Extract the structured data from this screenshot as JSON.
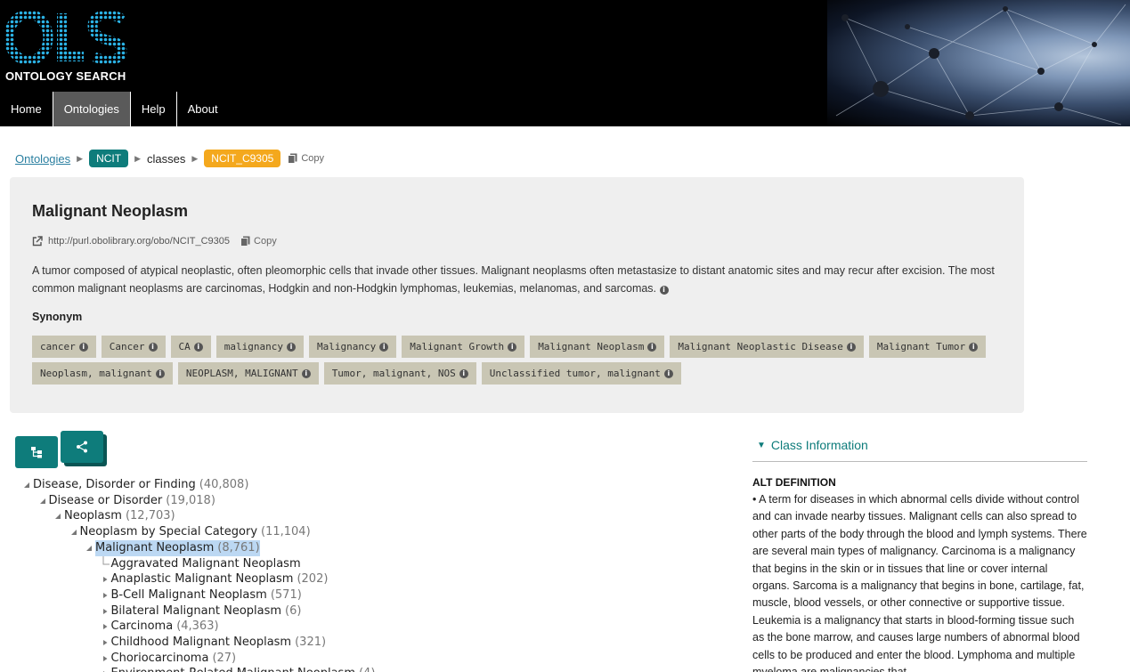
{
  "header": {
    "logo_letters": "OLS",
    "logo_subtitle": "ONTOLOGY SEARCH",
    "nav": [
      {
        "label": "Home"
      },
      {
        "label": "Ontologies"
      },
      {
        "label": "Help"
      },
      {
        "label": "About"
      }
    ],
    "active_nav": "Ontologies"
  },
  "breadcrumb": {
    "root": "Ontologies",
    "ontology": "NCIT",
    "type": "classes",
    "term_id": "NCIT_C9305",
    "copy_label": "Copy"
  },
  "term": {
    "title": "Malignant Neoplasm",
    "iri": "http://purl.obolibrary.org/obo/NCIT_C9305",
    "iri_copy_label": "Copy",
    "description": "A tumor composed of atypical neoplastic, often pleomorphic cells that invade other tissues. Malignant neoplasms often metastasize to distant anatomic sites and may recur after excision. The most common malignant neoplasms are carcinomas, Hodgkin and non-Hodgkin lymphomas, leukemias, melanomas, and sarcomas.",
    "synonym_label": "Synonym",
    "synonyms_row1": [
      "cancer",
      "Cancer",
      "CA",
      "malignancy",
      "Malignancy",
      "Malignant Growth",
      "Malignant Neoplasm",
      "Malignant Neoplastic Disease",
      "Malignant Tumor"
    ],
    "synonyms_row2": [
      "Neoplasm, malignant",
      "NEOPLASM, MALIGNANT",
      "Tumor, malignant, NOS",
      "Unclassified tumor, malignant"
    ]
  },
  "tree": {
    "rows": [
      {
        "label": "Disease, Disorder or Finding",
        "count": "(40,808)",
        "state": "open",
        "depth": 0
      },
      {
        "label": "Disease or Disorder",
        "count": "(19,018)",
        "state": "open",
        "depth": 1
      },
      {
        "label": "Neoplasm",
        "count": "(12,703)",
        "state": "open",
        "depth": 2
      },
      {
        "label": "Neoplasm by Special Category",
        "count": "(11,104)",
        "state": "open",
        "depth": 3
      },
      {
        "label": "Malignant Neoplasm",
        "count": "(8,761)",
        "state": "open",
        "depth": 4,
        "selected": true
      },
      {
        "label": "Aggravated Malignant Neoplasm",
        "count": "",
        "state": "leaf",
        "depth": 5
      },
      {
        "label": "Anaplastic Malignant Neoplasm",
        "count": "(202)",
        "state": "closed",
        "depth": 5
      },
      {
        "label": "B-Cell Malignant Neoplasm",
        "count": "(571)",
        "state": "closed",
        "depth": 5
      },
      {
        "label": "Bilateral Malignant Neoplasm",
        "count": "(6)",
        "state": "closed",
        "depth": 5
      },
      {
        "label": "Carcinoma",
        "count": "(4,363)",
        "state": "closed",
        "depth": 5
      },
      {
        "label": "Childhood Malignant Neoplasm",
        "count": "(321)",
        "state": "closed",
        "depth": 5
      },
      {
        "label": "Choriocarcinoma",
        "count": "(27)",
        "state": "closed",
        "depth": 5
      },
      {
        "label": "Environment-Related Malignant Neoplasm",
        "count": "(4)",
        "state": "closed",
        "depth": 5
      }
    ]
  },
  "class_info": {
    "header": "Class Information",
    "alt_def_label": "ALT DEFINITION",
    "alt_def_text": "• A term for diseases in which abnormal cells divide without control and can invade nearby tissues. Malignant cells can also spread to other parts of the body through the blood and lymph systems. There are several main types of malignancy. Carcinoma is a malignancy that begins in the skin or in tissues that line or cover internal organs. Sarcoma is a malignancy that begins in bone, cartilage, fat, muscle, blood vessels, or other connective or supportive tissue. Leukemia is a malignancy that starts in blood-forming tissue such as the bone marrow, and causes large numbers of abnormal blood cells to be produced and enter the blood. Lymphoma and multiple myeloma are malignancies that"
  },
  "colors": {
    "teal": "#0e7c7b",
    "orange": "#f4a81d",
    "chip": "#c9c6b4",
    "selected": "#bcd8f3"
  }
}
